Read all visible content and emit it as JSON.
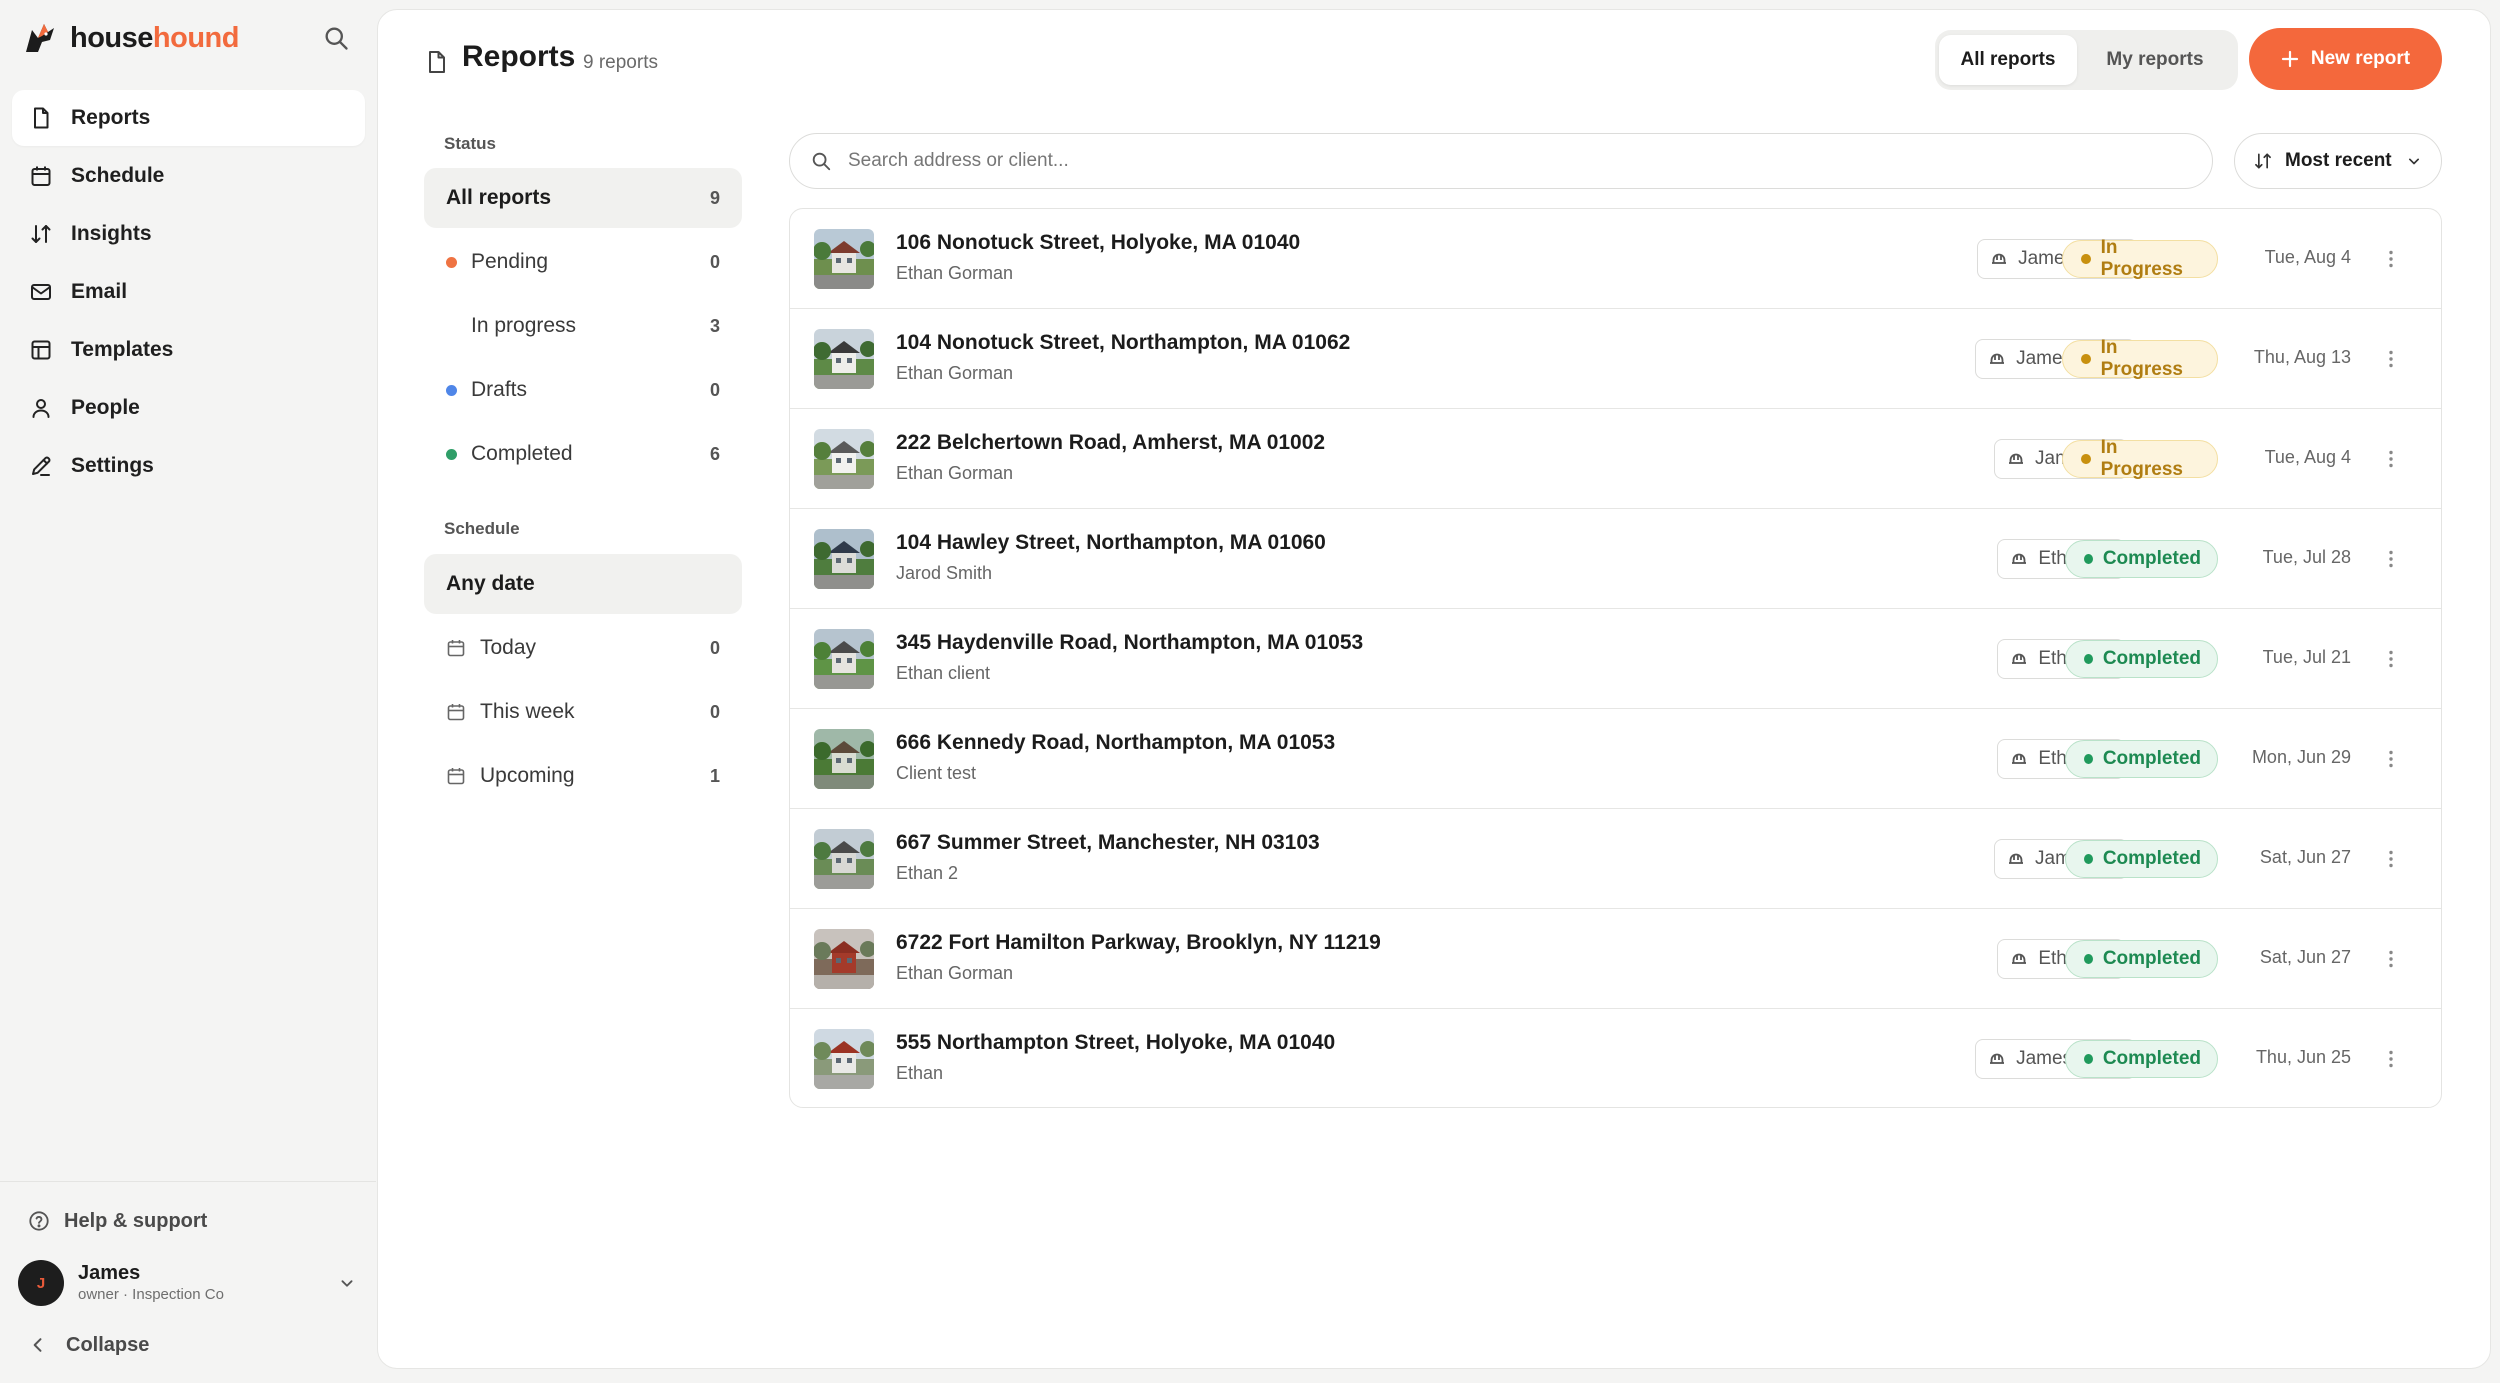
{
  "brand": {
    "name_part1": "house",
    "name_part2": "hound",
    "accent": "#f26a3d"
  },
  "sidebar": {
    "items": [
      {
        "label": "Reports",
        "icon": "document-icon",
        "active": true
      },
      {
        "label": "Schedule",
        "icon": "calendar-icon"
      },
      {
        "label": "Insights",
        "icon": "sort-arrows-icon"
      },
      {
        "label": "Email",
        "icon": "mail-icon"
      },
      {
        "label": "Templates",
        "icon": "template-icon"
      },
      {
        "label": "People",
        "icon": "person-icon"
      },
      {
        "label": "Settings",
        "icon": "pen-icon"
      }
    ],
    "help": "Help & support",
    "user": {
      "initial": "J",
      "name": "James",
      "role": "owner · Inspection Co"
    },
    "collapse": "Collapse"
  },
  "header": {
    "title": "Reports",
    "count": "9 reports",
    "tabs": [
      "All reports",
      "My reports"
    ],
    "new_button": "New report"
  },
  "filters": {
    "status_heading": "Status",
    "status": [
      {
        "label": "All reports",
        "count": "9",
        "selected": true
      },
      {
        "label": "Pending",
        "count": "0",
        "dot": "#ef7342"
      },
      {
        "label": "In progress",
        "count": "3"
      },
      {
        "label": "Drafts",
        "count": "0",
        "dot": "#4f86e8"
      },
      {
        "label": "Completed",
        "count": "6",
        "dot": "#2f9e68"
      }
    ],
    "schedule_heading": "Schedule",
    "schedule": [
      {
        "label": "Any date",
        "count": "",
        "selected": true
      },
      {
        "label": "Today",
        "count": "0"
      },
      {
        "label": "This week",
        "count": "0"
      },
      {
        "label": "Upcoming",
        "count": "1"
      }
    ]
  },
  "search": {
    "placeholder": "Search address or client..."
  },
  "sort": {
    "label": "Most recent"
  },
  "reports": [
    {
      "address": "106 Nonotuck Street, Holyoke, MA 01040",
      "client": "Ethan Gorman",
      "assignee": "James +2",
      "status": "In Progress",
      "date": "Tue, Aug 4"
    },
    {
      "address": "104 Nonotuck Street, Northampton, MA 01062",
      "client": "Ethan Gorman",
      "assignee": "James +1",
      "status": "In Progress",
      "date": "Thu, Aug 13"
    },
    {
      "address": "222 Belchertown Road, Amherst, MA 01002",
      "client": "Ethan Gorman",
      "assignee": "James",
      "status": "In Progress",
      "date": "Tue, Aug 4"
    },
    {
      "address": "104 Hawley Street, Northampton, MA 01060",
      "client": "Jarod Smith",
      "assignee": "Ethan",
      "status": "Completed",
      "date": "Tue, Jul 28"
    },
    {
      "address": "345 Haydenville Road, Northampton, MA 01053",
      "client": "Ethan client",
      "assignee": "Ethan",
      "status": "Completed",
      "date": "Tue, Jul 21"
    },
    {
      "address": "666 Kennedy Road, Northampton, MA 01053",
      "client": "Client test",
      "assignee": "Ethan",
      "status": "Completed",
      "date": "Mon, Jun 29"
    },
    {
      "address": "667 Summer Street, Manchester, NH 03103",
      "client": "Ethan 2",
      "assignee": "James",
      "status": "Completed",
      "date": "Sat, Jun 27"
    },
    {
      "address": "6722 Fort Hamilton Parkway, Brooklyn, NY 11219",
      "client": "Ethan Gorman",
      "assignee": "Ethan",
      "status": "Completed",
      "date": "Sat, Jun 27"
    },
    {
      "address": "555 Northampton Street, Holyoke, MA 01040",
      "client": "Ethan",
      "assignee": "James +1",
      "status": "Completed",
      "date": "Thu, Jun 25"
    }
  ]
}
